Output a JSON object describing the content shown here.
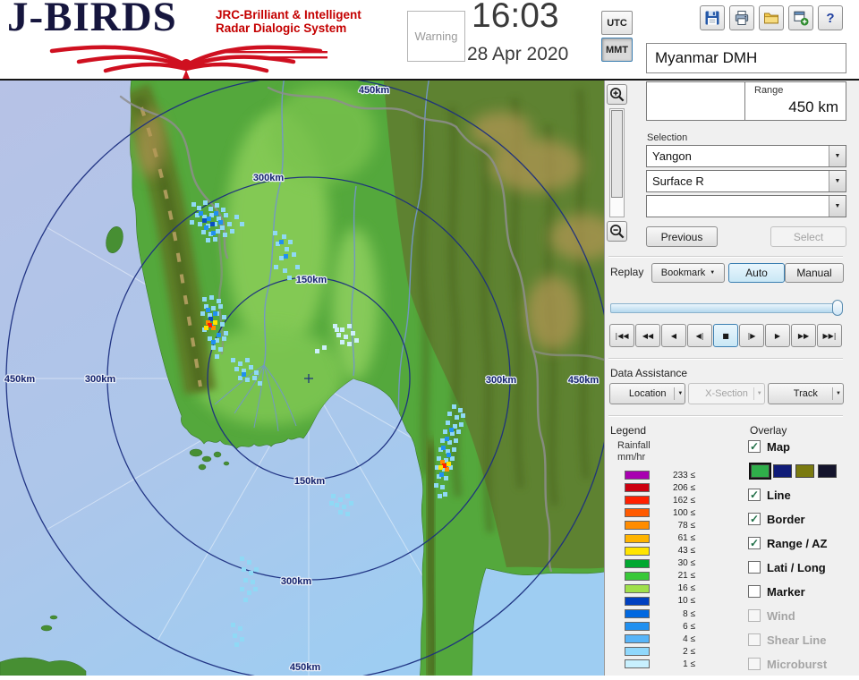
{
  "header": {
    "logo": {
      "title": "J-BIRDS",
      "subtitle_line1": "JRC-Brilliant & Intelligent",
      "subtitle_line2": "Radar  Dialogic  System"
    },
    "warning_button": "Warning",
    "clock": {
      "time": "16:03",
      "date": "28 Apr 2020"
    },
    "timezone": {
      "utc": "UTC",
      "mmt": "MMT",
      "selected": "MMT"
    },
    "station_name": "Myanmar DMH",
    "toolbar_icons": [
      "save",
      "print",
      "open",
      "add-window",
      "help"
    ]
  },
  "info_panel": {
    "range_label": "Range",
    "range_value": "450 km",
    "selection_label": "Selection",
    "site_dropdown": "Yangon",
    "product_dropdown": "Surface R",
    "extra_dropdown": "",
    "previous_button": "Previous",
    "select_button": "Select"
  },
  "replay": {
    "label": "Replay",
    "bookmark_button": "Bookmark",
    "auto_button": "Auto",
    "manual_button": "Manual",
    "active_mode": "Auto",
    "playback_buttons": [
      "|◀◀",
      "◀◀",
      "◀",
      "◀|",
      "■",
      "|▶",
      "▶",
      "▶▶",
      "▶▶|"
    ],
    "active_playback_index": 4
  },
  "data_assistance": {
    "label": "Data Assistance",
    "location_button": "Location",
    "xsection_button": "X-Section",
    "track_button": "Track"
  },
  "legend": {
    "title": "Legend",
    "unit_line1": "Rainfall",
    "unit_line2": "mm/hr",
    "entries": [
      {
        "value": "233 ≤",
        "color": "#a800b0"
      },
      {
        "value": "206 ≤",
        "color": "#cc0010"
      },
      {
        "value": "162 ≤",
        "color": "#ff2000"
      },
      {
        "value": "100 ≤",
        "color": "#ff5a00"
      },
      {
        "value": "78 ≤",
        "color": "#ff8c00"
      },
      {
        "value": "61 ≤",
        "color": "#ffb400"
      },
      {
        "value": "43 ≤",
        "color": "#ffe400"
      },
      {
        "value": "30 ≤",
        "color": "#00a830"
      },
      {
        "value": "21 ≤",
        "color": "#38c838"
      },
      {
        "value": "16 ≤",
        "color": "#9fe04a"
      },
      {
        "value": "10 ≤",
        "color": "#0040c0"
      },
      {
        "value": "8 ≤",
        "color": "#0068e0"
      },
      {
        "value": "6 ≤",
        "color": "#2090f0"
      },
      {
        "value": "4 ≤",
        "color": "#58b4f8"
      },
      {
        "value": "2 ≤",
        "color": "#90d8fc"
      },
      {
        "value": "1 ≤",
        "color": "#c8f0fe"
      }
    ]
  },
  "overlay": {
    "title": "Overlay",
    "map_swatches": [
      "#2fae4a",
      "#101c78",
      "#7a7a10",
      "#14142c"
    ],
    "items": [
      {
        "label": "Map",
        "checked": true,
        "enabled": true
      },
      {
        "label": "Line",
        "checked": true,
        "enabled": true
      },
      {
        "label": "Border",
        "checked": true,
        "enabled": true
      },
      {
        "label": "Range / AZ",
        "checked": true,
        "enabled": true
      },
      {
        "label": "Lati / Long",
        "checked": false,
        "enabled": true
      },
      {
        "label": "Marker",
        "checked": false,
        "enabled": true
      },
      {
        "label": "Wind",
        "checked": false,
        "enabled": false
      },
      {
        "label": "Shear Line",
        "checked": false,
        "enabled": false
      },
      {
        "label": "Microburst",
        "checked": false,
        "enabled": false
      }
    ]
  },
  "map": {
    "ring_labels": [
      "450km",
      "300km",
      "150km",
      "150km",
      "300km",
      "450km",
      "450km",
      "300km",
      "300km",
      "450km"
    ]
  },
  "icons": {
    "dropdown_arrow": "▼",
    "check": "✓"
  }
}
